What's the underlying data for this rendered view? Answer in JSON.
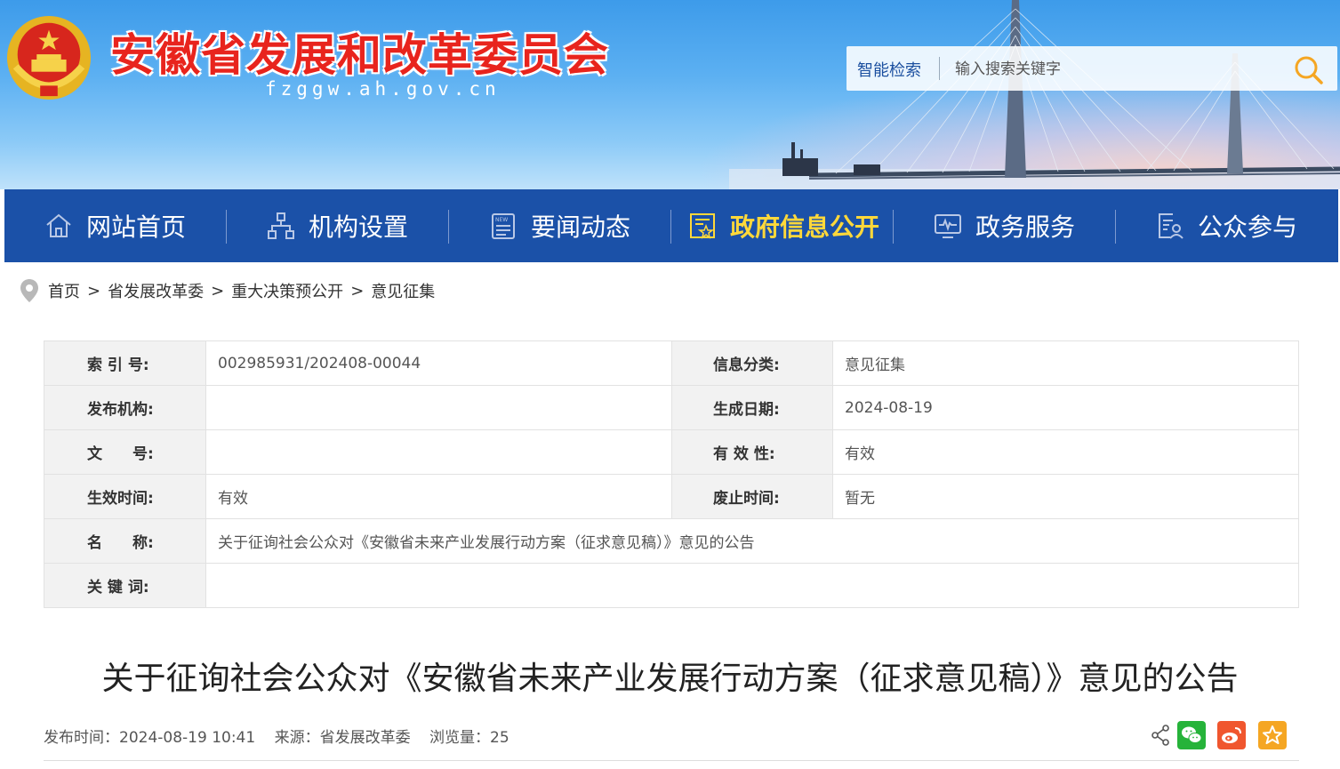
{
  "header": {
    "site_title": "安徽省发展和改革委员会",
    "domain": "fzggw.ah.gov.cn",
    "search": {
      "label": "智能检索",
      "placeholder": "输入搜索关键字"
    }
  },
  "nav": {
    "items": [
      {
        "label": "网站首页",
        "icon": "home-icon"
      },
      {
        "label": "机构设置",
        "icon": "org-chart-icon"
      },
      {
        "label": "要闻动态",
        "icon": "news-icon"
      },
      {
        "label": "政府信息公开",
        "icon": "info-disclosure-icon",
        "active": true
      },
      {
        "label": "政务服务",
        "icon": "monitor-icon"
      },
      {
        "label": "公众参与",
        "icon": "participation-icon"
      }
    ],
    "active_color": "#ffd83a",
    "bar_color": "#1b51a8"
  },
  "breadcrumb": {
    "items": [
      "首页",
      "省发展改革委",
      "重大决策预公开",
      "意见征集"
    ],
    "separator": ">"
  },
  "info": {
    "index_no_label": "索 引 号:",
    "index_no": "002985931/202408-00044",
    "category_label": "信息分类:",
    "category": "意见征集",
    "publisher_label": "发布机构:",
    "publisher": "",
    "gen_date_label": "生成日期:",
    "gen_date": "2024-08-19",
    "doc_no_label": "文　　号:",
    "doc_no": "",
    "validity_label": "有 效 性:",
    "validity": "有效",
    "effective_label": "生效时间:",
    "effective": "有效",
    "expire_label": "废止时间:",
    "expire": "暂无",
    "name_label": "名　　称:",
    "name": "关于征询社会公众对《安徽省未来产业发展行动方案（征求意见稿）》意见的公告",
    "keywords_label": "关 键 词:",
    "keywords": ""
  },
  "article": {
    "title": "关于征询社会公众对《安徽省未来产业发展行动方案（征求意见稿）》意见的公告",
    "publish_time": "发布时间：2024-08-19 10:41",
    "source": "来源：省发展改革委",
    "views": "浏览量：25"
  },
  "share": {
    "icons": [
      "share-icon",
      "wechat-icon",
      "weibo-icon",
      "favorite-icon"
    ],
    "colors": {
      "wechat": "#26b33a",
      "weibo": "#f0562e",
      "favorite": "#f5a623"
    }
  }
}
